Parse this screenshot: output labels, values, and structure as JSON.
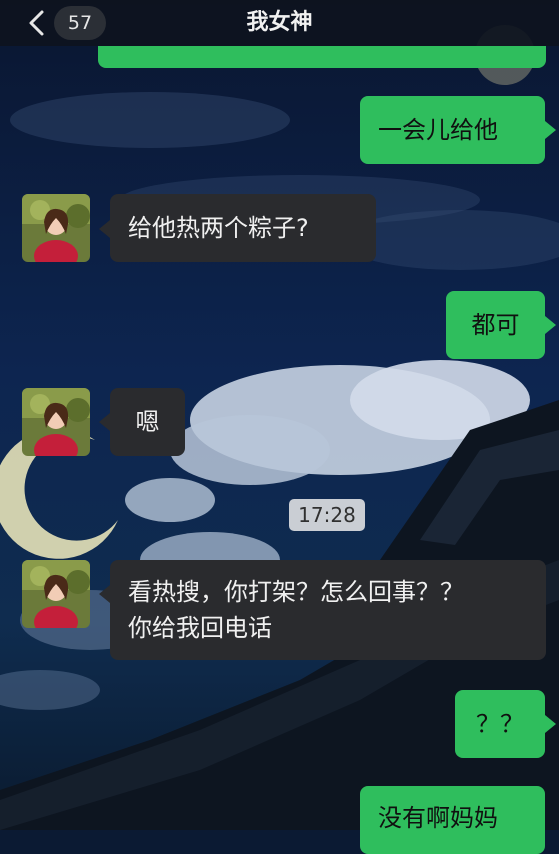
{
  "header": {
    "title": "我女神",
    "unread_count": "57"
  },
  "messages": [
    {
      "from": "me",
      "text": "一会儿给他"
    },
    {
      "from": "them",
      "text": "给他热两个粽子?"
    },
    {
      "from": "me",
      "text": "都可"
    },
    {
      "from": "them",
      "text": "嗯"
    },
    {
      "timestamp": "17:28"
    },
    {
      "from": "them",
      "lines": [
        "看热搜，你打架？怎么回事？？",
        "你给我回电话"
      ]
    },
    {
      "from": "me",
      "text": "？？"
    },
    {
      "from": "me",
      "text": "没有啊妈妈"
    }
  ],
  "colors": {
    "my_bubble": "#2fbe5d",
    "their_bubble": "#2a2b2e",
    "header_bg": "#0e141e"
  },
  "icons": {
    "back": "chevron-left-icon",
    "avatar": "woman-portrait-avatar"
  }
}
